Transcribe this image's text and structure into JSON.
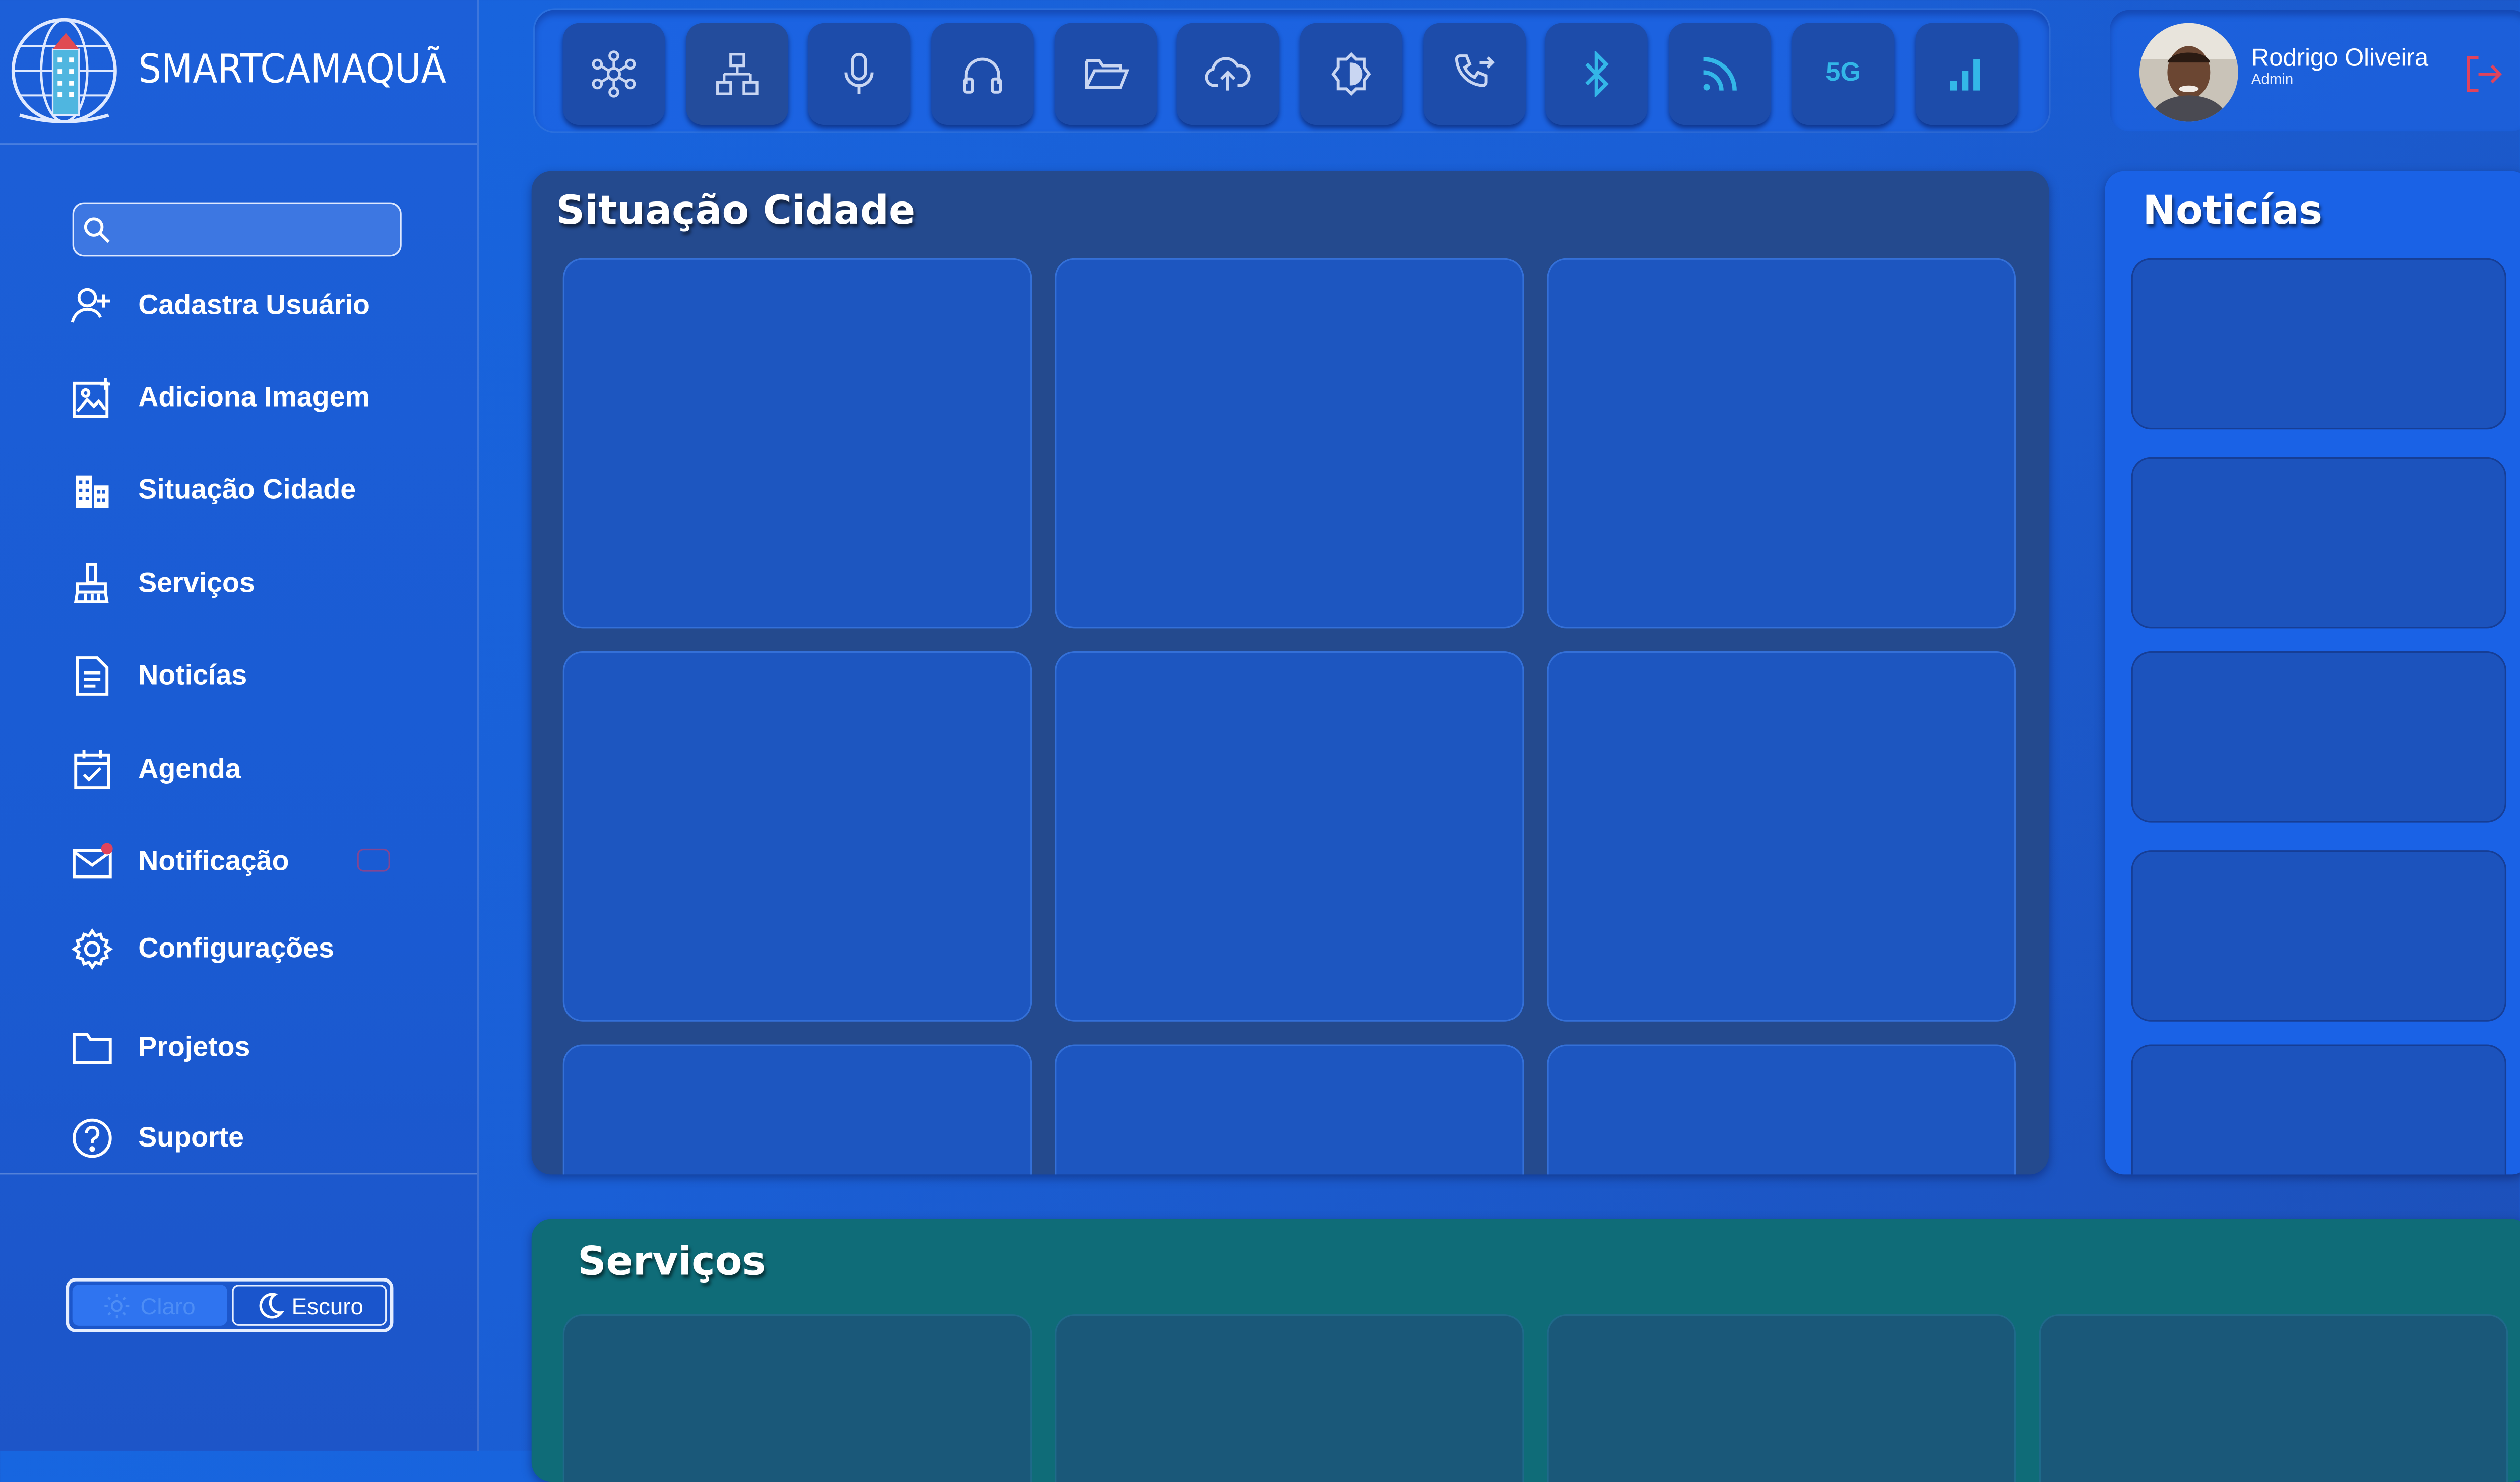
{
  "app": {
    "logo_text": "SMARTCAMAQUÃ"
  },
  "search": {
    "placeholder": "",
    "value": ""
  },
  "sidebar": {
    "items": [
      {
        "label": "Cadastra Usuário",
        "icon": "user-plus-icon"
      },
      {
        "label": "Adiciona Imagem",
        "icon": "image-plus-icon"
      },
      {
        "label": "Situação Cidade",
        "icon": "buildings-icon"
      },
      {
        "label": "Serviços",
        "icon": "broom-icon"
      },
      {
        "label": "Noticías",
        "icon": "document-icon"
      },
      {
        "label": "Agenda",
        "icon": "calendar-check-icon"
      },
      {
        "label": "Notificação",
        "icon": "mail-icon"
      },
      {
        "label": "Configurações",
        "icon": "gear-icon"
      },
      {
        "label": "Projetos",
        "icon": "folder-icon"
      },
      {
        "label": "Suporte",
        "icon": "help-icon"
      }
    ]
  },
  "theme": {
    "light_label": "Claro",
    "dark_label": "Escuro",
    "selected": "Escuro"
  },
  "toolbar": {
    "buttons": [
      "network-icon",
      "hierarchy-icon",
      "microphone-icon",
      "headphones-icon",
      "folder-open-icon",
      "cloud-upload-icon",
      "brightness-icon",
      "phone-forward-icon",
      "bluetooth-icon",
      "rss-icon",
      "5g-icon",
      "signal-bars-icon"
    ],
    "fiveg_label": "5G"
  },
  "user": {
    "name": "Rodrigo Oliveira",
    "role": "Admin"
  },
  "panels": {
    "city_title": "Situação Cidade",
    "news_title": "Noticías",
    "services_title": "Serviços"
  },
  "colors": {
    "accent_cyan": "#33b7e8",
    "logout_red": "#e0435c",
    "panel_city": "#244a8e",
    "panel_services": "#0f6c78"
  }
}
